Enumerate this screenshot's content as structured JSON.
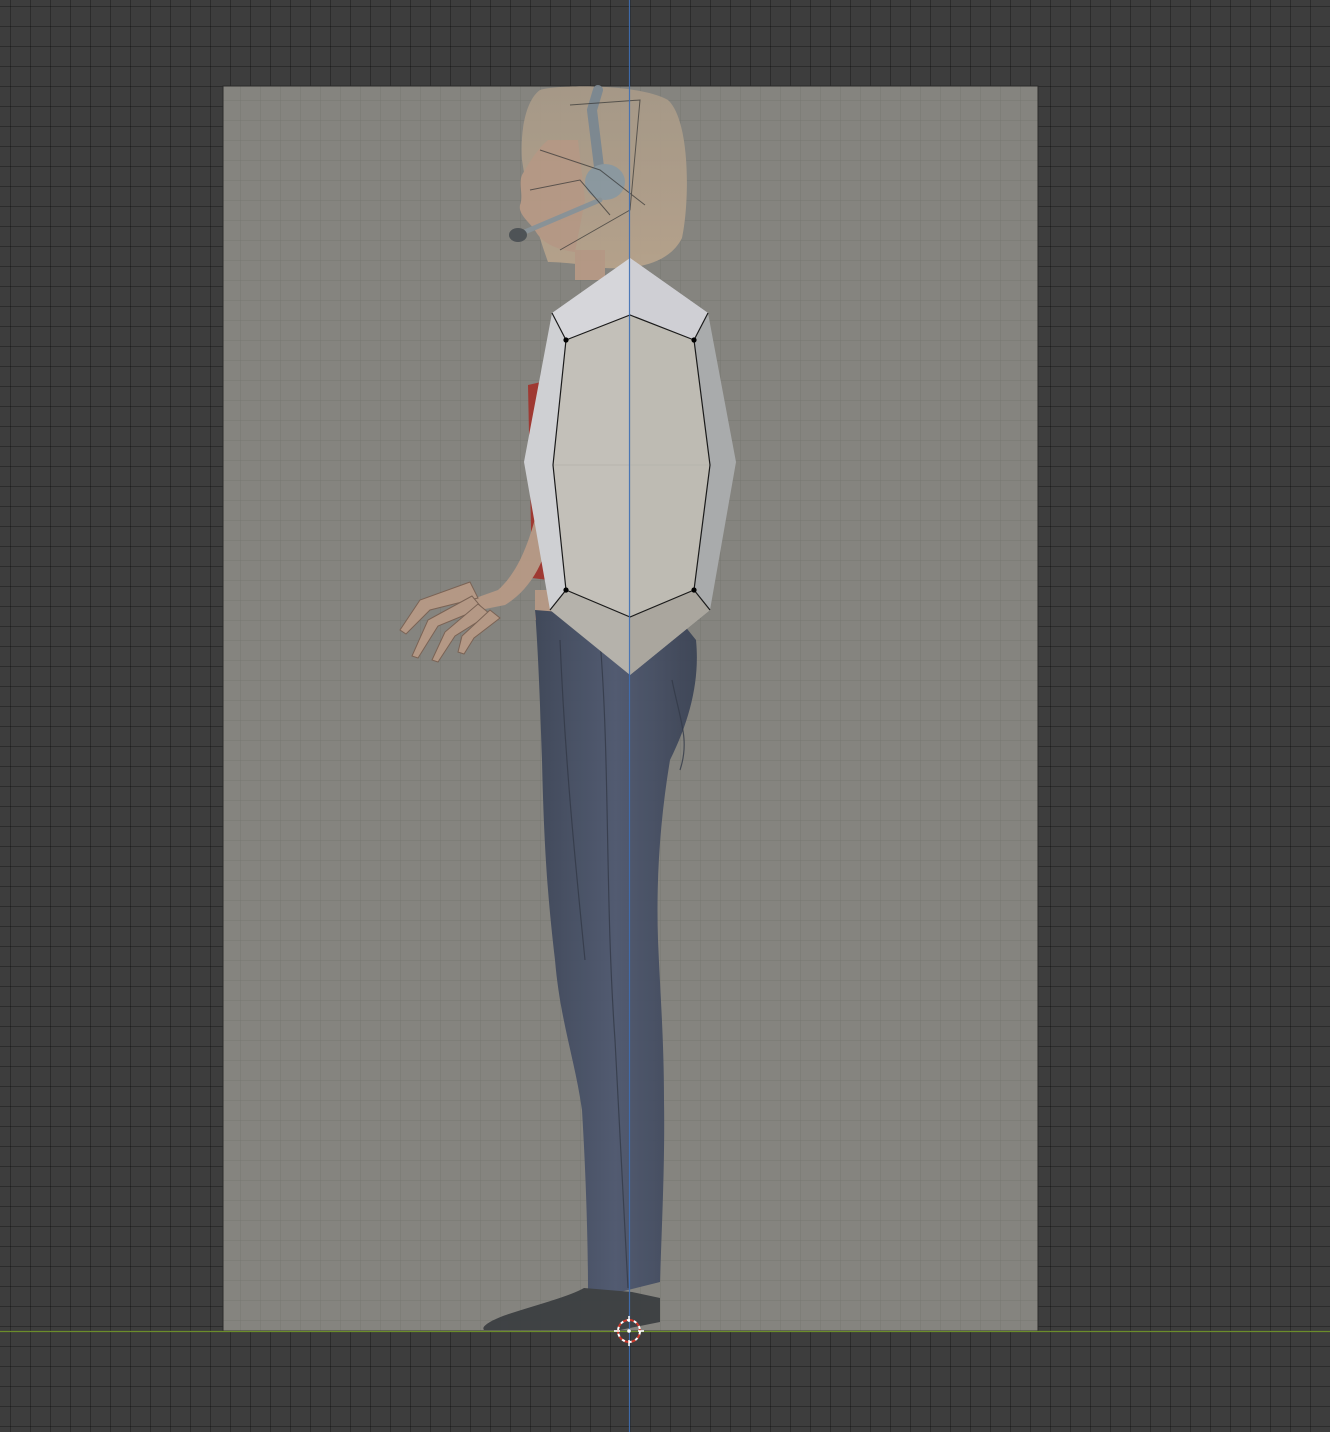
{
  "viewport": {
    "background": "#3d3d3d",
    "grid_color": "#2f2f2f",
    "x_axis_color": "#6b8c2a",
    "z_axis_color": "#3f6fb5",
    "reference_plane_color": "#85847f"
  },
  "scene": {
    "reference_image": "character-side-view",
    "mesh": {
      "mode": "edit",
      "shape": "low-poly-octagon-prism",
      "face_colors": {
        "front": "#c3c0b9",
        "top": "#d6d6da",
        "side_left": "#cfd0d3",
        "side_right": "#aeafb0",
        "bottom": "#b5b2ab"
      }
    },
    "cursor_3d": "3d-cursor-icon"
  }
}
